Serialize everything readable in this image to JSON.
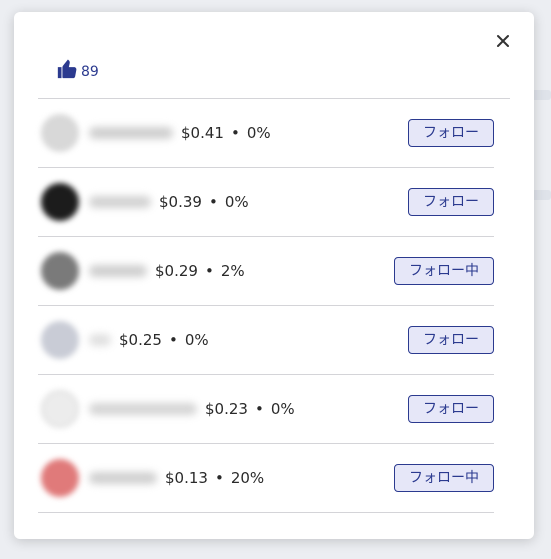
{
  "likes": {
    "count": "89"
  },
  "close": {
    "label": "×"
  },
  "users": [
    {
      "price": "$0.41",
      "pct": "0%",
      "follow_label": "フォロー",
      "avatar_color": "#d8d8d8",
      "name_color": "#cfcfcf"
    },
    {
      "price": "$0.39",
      "pct": "0%",
      "follow_label": "フォロー",
      "avatar_color": "#1c1c1c",
      "name_color": "#d2d2d2"
    },
    {
      "price": "$0.29",
      "pct": "2%",
      "follow_label": "フォロー中",
      "avatar_color": "#7a7a7a",
      "name_color": "#cfcfcf"
    },
    {
      "price": "$0.25",
      "pct": "0%",
      "follow_label": "フォロー",
      "avatar_color": "#c9ccd6",
      "name_color": "#e0e0e0"
    },
    {
      "price": "$0.23",
      "pct": "0%",
      "follow_label": "フォロー",
      "avatar_color": "#ececec",
      "name_color": "#d5d5d5"
    },
    {
      "price": "$0.13",
      "pct": "20%",
      "follow_label": "フォロー中",
      "avatar_color": "#e07a7a",
      "name_color": "#d0d0d0"
    }
  ],
  "colors": {
    "accent": "#2b3a8f",
    "button_bg": "#e6e7f8",
    "divider": "#d4d4d8"
  }
}
